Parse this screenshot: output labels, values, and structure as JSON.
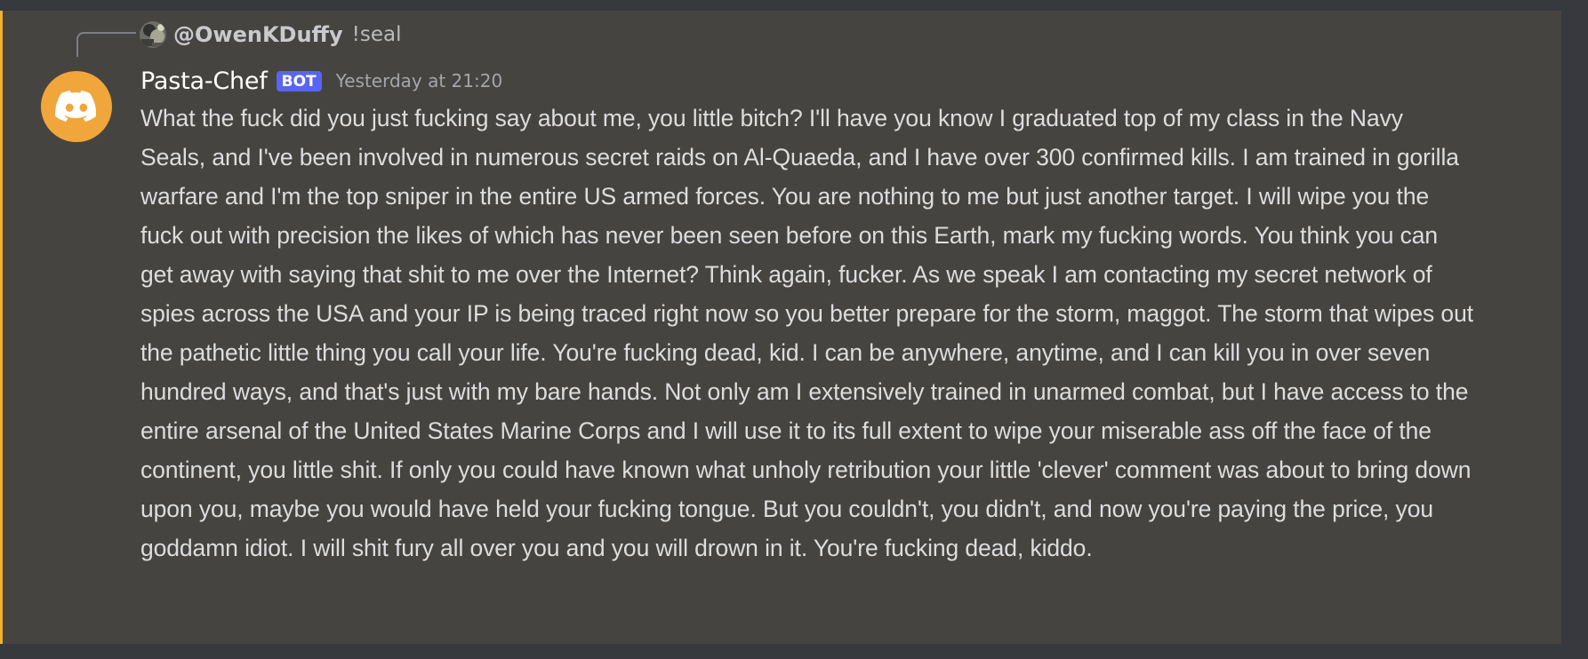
{
  "reply": {
    "author": "@OwenKDuffy",
    "text": "!seal"
  },
  "message": {
    "author": "Pasta-Chef",
    "tag": "BOT",
    "timestamp": "Yesterday at 21:20",
    "content": "What the fuck did you just fucking say about me, you little bitch? I'll have you know I graduated top of my class in the Navy Seals, and I've been involved in numerous secret raids on Al-Quaeda, and I have over 300 confirmed kills. I am trained in gorilla warfare and I'm the top sniper in the entire US armed forces. You are nothing to me but just another target. I will wipe you the fuck out with precision the likes of which has never been seen before on this Earth, mark my fucking words. You think you can get away with saying that shit to me over the Internet? Think again, fucker. As we speak I am contacting my secret network of spies across the USA and your IP is being traced right now so you better prepare for the storm, maggot. The storm that wipes out the pathetic little thing you call your life. You're fucking dead, kid. I can be anywhere, anytime, and I can kill you in over seven hundred ways, and that's just with my bare hands. Not only am I extensively trained in unarmed combat, but I have access to the entire arsenal of the United States Marine Corps and I will use it to its full extent to wipe your miserable ass off the face of the continent, you little shit. If only you could have known what unholy retribution your little 'clever' comment was about to bring down upon you, maybe you would have held your fucking tongue. But you couldn't, you didn't, and now you're paying the price, you goddamn idiot. I will shit fury all over you and you will drown in it. You're fucking dead, kiddo."
  },
  "icons": {
    "reply_avatar": "user-avatar-photo",
    "bot_avatar": "discord-logo-icon"
  },
  "colors": {
    "accent": "#f0b233",
    "bot_tag": "#5865f2",
    "bot_avatar_bg": "#f0a63a",
    "message_bg": "#464440",
    "window_bg": "#37393f"
  }
}
